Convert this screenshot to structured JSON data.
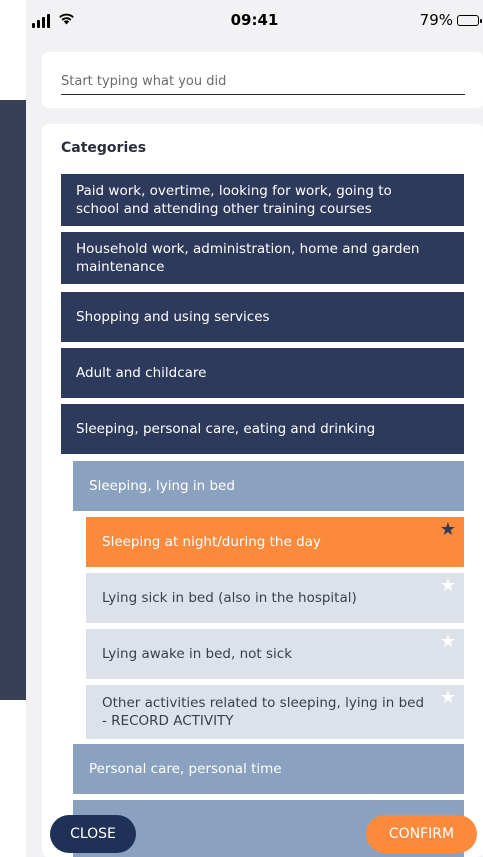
{
  "status_bar": {
    "time": "09:41",
    "battery_percent": "79%",
    "battery_level": 0.79,
    "wifi_icon": "wifi-icon",
    "signal_icon": "signal-icon"
  },
  "search": {
    "placeholder": "Start typing what you did",
    "value": ""
  },
  "categories": {
    "heading": "Categories",
    "rows": [
      {
        "label": "Paid work, overtime, looking for work, going to school and attending other training courses",
        "level": 0
      },
      {
        "label": "Household work, administration, home and garden maintenance",
        "level": 0
      },
      {
        "label": "Shopping and using services",
        "level": 0
      },
      {
        "label": "Adult and childcare",
        "level": 0
      },
      {
        "label": "Sleeping, personal care, eating and drinking",
        "level": 0
      },
      {
        "label": "Sleeping, lying in bed",
        "level": 1
      },
      {
        "label": "Sleeping at night/during the day",
        "level": 2,
        "selected": true,
        "starred": true
      },
      {
        "label": "Lying sick in bed (also in the hospital)",
        "level": 2,
        "starred": false
      },
      {
        "label": "Lying awake in bed, not sick",
        "level": 2,
        "starred": false
      },
      {
        "label": "Other activities related to sleeping, lying in bed - RECORD ACTIVITY",
        "level": 2,
        "starred": false
      },
      {
        "label": "Personal care, personal time",
        "level": 1
      },
      {
        "label": "",
        "level": 1
      }
    ]
  },
  "buttons": {
    "close_label": "CLOSE",
    "confirm_label": "CONFIRM"
  },
  "colors": {
    "level0": "#2d3a5c",
    "level1": "#8aa1bf",
    "level2": "#dde1ea",
    "selected": "#fb8a3c",
    "close_button": "#1f3156",
    "confirm_button": "#fb8a3c"
  }
}
